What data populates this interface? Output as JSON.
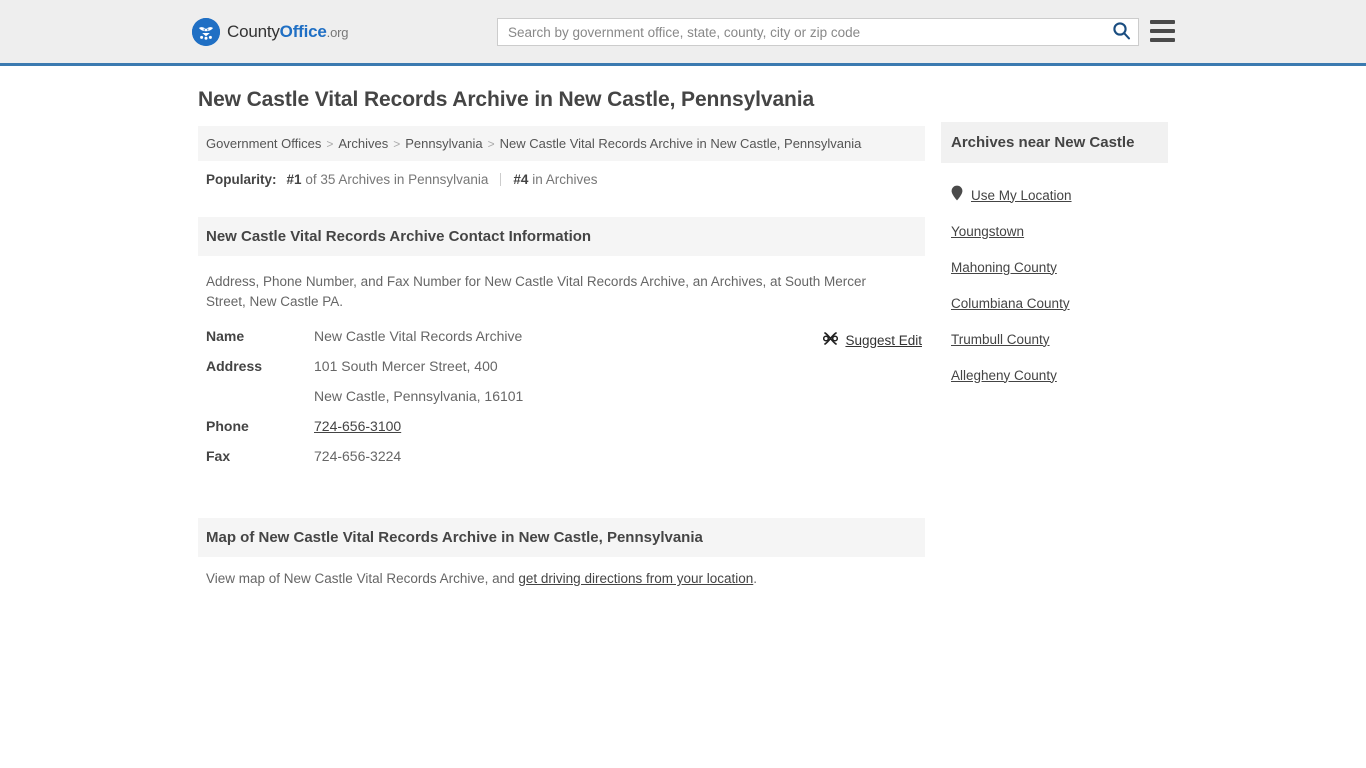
{
  "header": {
    "logo": {
      "icon": "countyoffice-eagle-logo-icon",
      "text_county": "County",
      "text_office": "Office",
      "text_org": ".org"
    },
    "search": {
      "placeholder": "Search by government office, state, county, city or zip code",
      "value": "",
      "search_icon": "search-icon"
    },
    "menu_icon": "hamburger-menu-icon",
    "accent_color": "#3b7ab0",
    "background_color": "#eeeeee"
  },
  "page": {
    "title": "New Castle Vital Records Archive in New Castle, Pennsylvania"
  },
  "breadcrumb": {
    "separator": ">",
    "items": [
      {
        "label": "Government Offices"
      },
      {
        "label": "Archives"
      },
      {
        "label": "Pennsylvania"
      },
      {
        "label": "New Castle Vital Records Archive in New Castle, Pennsylvania"
      }
    ]
  },
  "popularity": {
    "label": "Popularity:",
    "rank_primary": "#1",
    "rank_primary_suffix": "of 35 Archives in Pennsylvania",
    "rank_secondary": "#4",
    "rank_secondary_suffix": "in Archives"
  },
  "contact_section": {
    "heading": "New Castle Vital Records Archive Contact Information",
    "description": "Address, Phone Number, and Fax Number for New Castle Vital Records Archive, an Archives, at South Mercer Street, New Castle PA.",
    "suggest_edit": {
      "label": "Suggest Edit",
      "icon": "suggest-edit-icon"
    },
    "rows": [
      {
        "label": "Name",
        "value": "New Castle Vital Records Archive",
        "link": false
      },
      {
        "label": "Address",
        "value": "101 South Mercer Street, 400",
        "link": false
      },
      {
        "label": "",
        "value": "New Castle, Pennsylvania, 16101",
        "link": false
      },
      {
        "label": "Phone",
        "value": "724-656-3100",
        "link": true
      },
      {
        "label": "Fax",
        "value": "724-656-3224",
        "link": false
      }
    ]
  },
  "map_section": {
    "heading": "Map of New Castle Vital Records Archive in New Castle, Pennsylvania",
    "description_prefix": "View map of New Castle Vital Records Archive, and ",
    "link_label": "get driving directions from your location",
    "description_suffix": "."
  },
  "sidebar": {
    "heading": "Archives near New Castle",
    "items": [
      {
        "label": "Use My Location",
        "icon": "location-pin-icon"
      },
      {
        "label": "Youngstown",
        "icon": ""
      },
      {
        "label": "Mahoning County",
        "icon": ""
      },
      {
        "label": "Columbiana County",
        "icon": ""
      },
      {
        "label": "Trumbull County",
        "icon": ""
      },
      {
        "label": "Allegheny County",
        "icon": ""
      }
    ]
  }
}
